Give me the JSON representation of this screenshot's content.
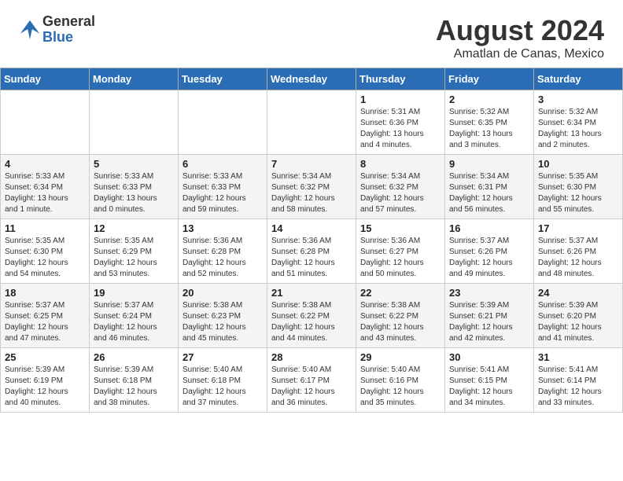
{
  "header": {
    "logo_general": "General",
    "logo_blue": "Blue",
    "month_year": "August 2024",
    "location": "Amatlan de Canas, Mexico"
  },
  "days_of_week": [
    "Sunday",
    "Monday",
    "Tuesday",
    "Wednesday",
    "Thursday",
    "Friday",
    "Saturday"
  ],
  "weeks": [
    {
      "row_class": "week-row-1",
      "days": [
        {
          "num": "",
          "info": "",
          "empty": true
        },
        {
          "num": "",
          "info": "",
          "empty": true
        },
        {
          "num": "",
          "info": "",
          "empty": true
        },
        {
          "num": "",
          "info": "",
          "empty": true
        },
        {
          "num": "1",
          "info": "Sunrise: 5:31 AM\nSunset: 6:36 PM\nDaylight: 13 hours\nand 4 minutes."
        },
        {
          "num": "2",
          "info": "Sunrise: 5:32 AM\nSunset: 6:35 PM\nDaylight: 13 hours\nand 3 minutes."
        },
        {
          "num": "3",
          "info": "Sunrise: 5:32 AM\nSunset: 6:34 PM\nDaylight: 13 hours\nand 2 minutes."
        }
      ]
    },
    {
      "row_class": "week-row-2",
      "days": [
        {
          "num": "4",
          "info": "Sunrise: 5:33 AM\nSunset: 6:34 PM\nDaylight: 13 hours\nand 1 minute."
        },
        {
          "num": "5",
          "info": "Sunrise: 5:33 AM\nSunset: 6:33 PM\nDaylight: 13 hours\nand 0 minutes."
        },
        {
          "num": "6",
          "info": "Sunrise: 5:33 AM\nSunset: 6:33 PM\nDaylight: 12 hours\nand 59 minutes."
        },
        {
          "num": "7",
          "info": "Sunrise: 5:34 AM\nSunset: 6:32 PM\nDaylight: 12 hours\nand 58 minutes."
        },
        {
          "num": "8",
          "info": "Sunrise: 5:34 AM\nSunset: 6:32 PM\nDaylight: 12 hours\nand 57 minutes."
        },
        {
          "num": "9",
          "info": "Sunrise: 5:34 AM\nSunset: 6:31 PM\nDaylight: 12 hours\nand 56 minutes."
        },
        {
          "num": "10",
          "info": "Sunrise: 5:35 AM\nSunset: 6:30 PM\nDaylight: 12 hours\nand 55 minutes."
        }
      ]
    },
    {
      "row_class": "week-row-3",
      "days": [
        {
          "num": "11",
          "info": "Sunrise: 5:35 AM\nSunset: 6:30 PM\nDaylight: 12 hours\nand 54 minutes."
        },
        {
          "num": "12",
          "info": "Sunrise: 5:35 AM\nSunset: 6:29 PM\nDaylight: 12 hours\nand 53 minutes."
        },
        {
          "num": "13",
          "info": "Sunrise: 5:36 AM\nSunset: 6:28 PM\nDaylight: 12 hours\nand 52 minutes."
        },
        {
          "num": "14",
          "info": "Sunrise: 5:36 AM\nSunset: 6:28 PM\nDaylight: 12 hours\nand 51 minutes."
        },
        {
          "num": "15",
          "info": "Sunrise: 5:36 AM\nSunset: 6:27 PM\nDaylight: 12 hours\nand 50 minutes."
        },
        {
          "num": "16",
          "info": "Sunrise: 5:37 AM\nSunset: 6:26 PM\nDaylight: 12 hours\nand 49 minutes."
        },
        {
          "num": "17",
          "info": "Sunrise: 5:37 AM\nSunset: 6:26 PM\nDaylight: 12 hours\nand 48 minutes."
        }
      ]
    },
    {
      "row_class": "week-row-4",
      "days": [
        {
          "num": "18",
          "info": "Sunrise: 5:37 AM\nSunset: 6:25 PM\nDaylight: 12 hours\nand 47 minutes."
        },
        {
          "num": "19",
          "info": "Sunrise: 5:37 AM\nSunset: 6:24 PM\nDaylight: 12 hours\nand 46 minutes."
        },
        {
          "num": "20",
          "info": "Sunrise: 5:38 AM\nSunset: 6:23 PM\nDaylight: 12 hours\nand 45 minutes."
        },
        {
          "num": "21",
          "info": "Sunrise: 5:38 AM\nSunset: 6:22 PM\nDaylight: 12 hours\nand 44 minutes."
        },
        {
          "num": "22",
          "info": "Sunrise: 5:38 AM\nSunset: 6:22 PM\nDaylight: 12 hours\nand 43 minutes."
        },
        {
          "num": "23",
          "info": "Sunrise: 5:39 AM\nSunset: 6:21 PM\nDaylight: 12 hours\nand 42 minutes."
        },
        {
          "num": "24",
          "info": "Sunrise: 5:39 AM\nSunset: 6:20 PM\nDaylight: 12 hours\nand 41 minutes."
        }
      ]
    },
    {
      "row_class": "week-row-5",
      "days": [
        {
          "num": "25",
          "info": "Sunrise: 5:39 AM\nSunset: 6:19 PM\nDaylight: 12 hours\nand 40 minutes."
        },
        {
          "num": "26",
          "info": "Sunrise: 5:39 AM\nSunset: 6:18 PM\nDaylight: 12 hours\nand 38 minutes."
        },
        {
          "num": "27",
          "info": "Sunrise: 5:40 AM\nSunset: 6:18 PM\nDaylight: 12 hours\nand 37 minutes."
        },
        {
          "num": "28",
          "info": "Sunrise: 5:40 AM\nSunset: 6:17 PM\nDaylight: 12 hours\nand 36 minutes."
        },
        {
          "num": "29",
          "info": "Sunrise: 5:40 AM\nSunset: 6:16 PM\nDaylight: 12 hours\nand 35 minutes."
        },
        {
          "num": "30",
          "info": "Sunrise: 5:41 AM\nSunset: 6:15 PM\nDaylight: 12 hours\nand 34 minutes."
        },
        {
          "num": "31",
          "info": "Sunrise: 5:41 AM\nSunset: 6:14 PM\nDaylight: 12 hours\nand 33 minutes."
        }
      ]
    }
  ]
}
